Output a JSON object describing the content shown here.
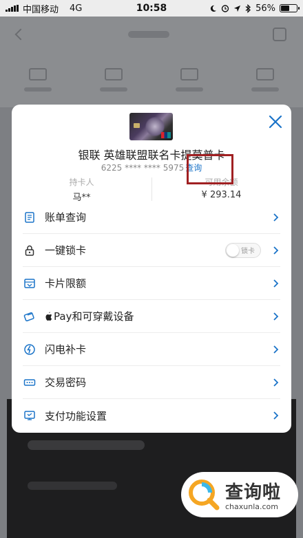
{
  "status_bar": {
    "carrier": "中国移动",
    "network": "4G",
    "time": "10:58",
    "battery": "56%",
    "battery_level": 0.56
  },
  "card": {
    "name": "银联 英雄联盟联名卡提莫普卡",
    "number": "6225 **** **** 5975",
    "query_label": "查询",
    "holder_label": "持卡人",
    "holder_value": "马**",
    "balance_label": "可用余额",
    "balance_value": "¥ 293.14"
  },
  "menu": {
    "items": [
      {
        "label": "账单查询",
        "icon": "bill-icon"
      },
      {
        "label": "一键锁卡",
        "icon": "lock-icon",
        "toggle_label": "锁卡"
      },
      {
        "label": "卡片限额",
        "icon": "limit-icon"
      },
      {
        "label": "Pay和可穿戴设备",
        "icon": "apple-pay-icon"
      },
      {
        "label": "闪电补卡",
        "icon": "lightning-icon"
      },
      {
        "label": "交易密码",
        "icon": "password-icon"
      },
      {
        "label": "支付功能设置",
        "icon": "payment-settings-icon"
      }
    ]
  },
  "watermark": {
    "name": "查询啦",
    "domain": "chaxunla.com"
  },
  "colors": {
    "accent": "#1a73c8",
    "highlight": "#a02022"
  }
}
